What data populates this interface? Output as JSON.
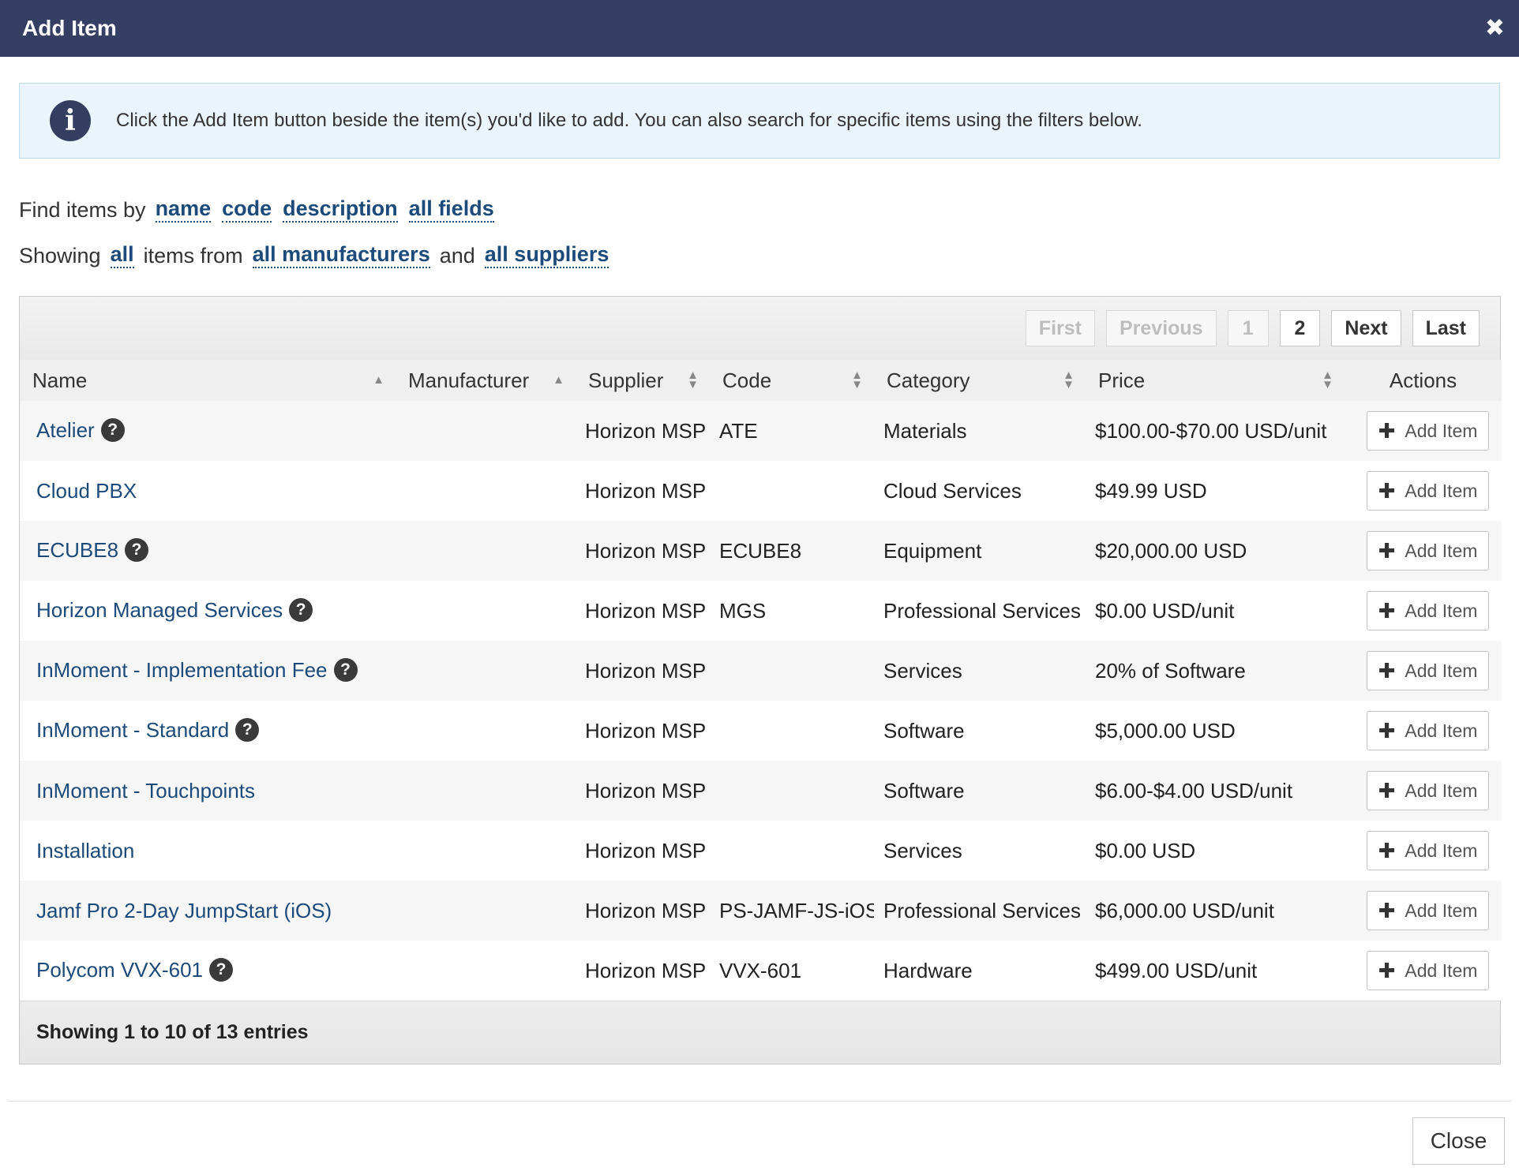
{
  "dialog": {
    "title": "Add Item",
    "close_icon": "close-icon",
    "close_button": "Close"
  },
  "info": {
    "icon": "info-icon",
    "message": "Click the Add Item button beside the item(s) you'd like to add. You can also search for specific items using the filters below."
  },
  "filters": {
    "find_prefix": "Find items by",
    "find_options": [
      "name",
      "code",
      "description",
      "all fields"
    ],
    "showing_prefix": "Showing",
    "showing_scope": "all",
    "items_from": "items from",
    "manufacturers": "all manufacturers",
    "and": "and",
    "suppliers": "all suppliers"
  },
  "pagination": {
    "first": "First",
    "previous": "Previous",
    "pages": [
      "1",
      "2"
    ],
    "next": "Next",
    "last": "Last"
  },
  "table": {
    "columns": [
      "Name",
      "Manufacturer",
      "Supplier",
      "Code",
      "Category",
      "Price",
      "Actions"
    ],
    "add_label": "Add Item",
    "rows": [
      {
        "name": "Atelier",
        "help": true,
        "manufacturer": "",
        "supplier": "Horizon MSP",
        "code": "ATE",
        "category": "Materials",
        "price": "$100.00-$70.00 USD/unit"
      },
      {
        "name": "Cloud PBX",
        "help": false,
        "manufacturer": "",
        "supplier": "Horizon MSP",
        "code": "",
        "category": "Cloud Services",
        "price": "$49.99 USD"
      },
      {
        "name": "ECUBE8",
        "help": true,
        "manufacturer": "",
        "supplier": "Horizon MSP",
        "code": "ECUBE8",
        "category": "Equipment",
        "price": "$20,000.00 USD"
      },
      {
        "name": "Horizon Managed Services",
        "help": true,
        "manufacturer": "",
        "supplier": "Horizon MSP",
        "code": "MGS",
        "category": "Professional Services",
        "price": "$0.00 USD/unit"
      },
      {
        "name": "InMoment - Implementation Fee",
        "help": true,
        "manufacturer": "",
        "supplier": "Horizon MSP",
        "code": "",
        "category": "Services",
        "price": "20% of Software"
      },
      {
        "name": "InMoment - Standard",
        "help": true,
        "manufacturer": "",
        "supplier": "Horizon MSP",
        "code": "",
        "category": "Software",
        "price": "$5,000.00 USD"
      },
      {
        "name": "InMoment - Touchpoints",
        "help": false,
        "manufacturer": "",
        "supplier": "Horizon MSP",
        "code": "",
        "category": "Software",
        "price": "$6.00-$4.00 USD/unit"
      },
      {
        "name": "Installation",
        "help": false,
        "manufacturer": "",
        "supplier": "Horizon MSP",
        "code": "",
        "category": "Services",
        "price": "$0.00 USD"
      },
      {
        "name": "Jamf Pro 2-Day JumpStart (iOS)",
        "help": false,
        "manufacturer": "",
        "supplier": "Horizon MSP",
        "code": "PS-JAMF-JS-iOS",
        "category": "Professional Services",
        "price": "$6,000.00 USD/unit"
      },
      {
        "name": "Polycom VVX-601",
        "help": true,
        "manufacturer": "",
        "supplier": "Horizon MSP",
        "code": "VVX-601",
        "category": "Hardware",
        "price": "$499.00 USD/unit"
      }
    ],
    "footer": "Showing 1 to 10 of 13 entries"
  }
}
